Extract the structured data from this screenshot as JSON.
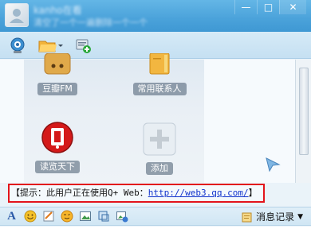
{
  "window": {
    "title_name": "kanho在看",
    "title_status": "清空了一个一遍删除一个一个",
    "minimize_icon": "minimize-icon",
    "maximize_icon": "maximize-icon",
    "close_icon": "close-icon"
  },
  "toolbar": {
    "items": [
      "video-camera-icon",
      "folder-share-icon",
      "add-app-icon"
    ]
  },
  "apps": [
    {
      "label": "豆瓣FM",
      "icon": "douban-fm-icon"
    },
    {
      "label": "常用联系人",
      "icon": "contacts-book-icon"
    },
    {
      "label": "读览天下",
      "icon": "reading-app-icon"
    },
    {
      "label": "添加",
      "icon": "add-plus-icon"
    }
  ],
  "notice": {
    "open_bracket": "【",
    "prefix": "提示：此用户正在使用Q+ Web：",
    "url": "http://web3.qq.com/",
    "close_bracket": "】"
  },
  "format_bar": {
    "items": [
      "font-icon",
      "emoji-icon",
      "note-icon",
      "wink-emoji-icon",
      "image-icon",
      "screenshot-icon",
      "send-image-icon"
    ],
    "history_label": "消息记录"
  },
  "colors": {
    "title_bar": "#4aa2da",
    "highlight_border": "#e3141b",
    "link": "#1133cc"
  }
}
